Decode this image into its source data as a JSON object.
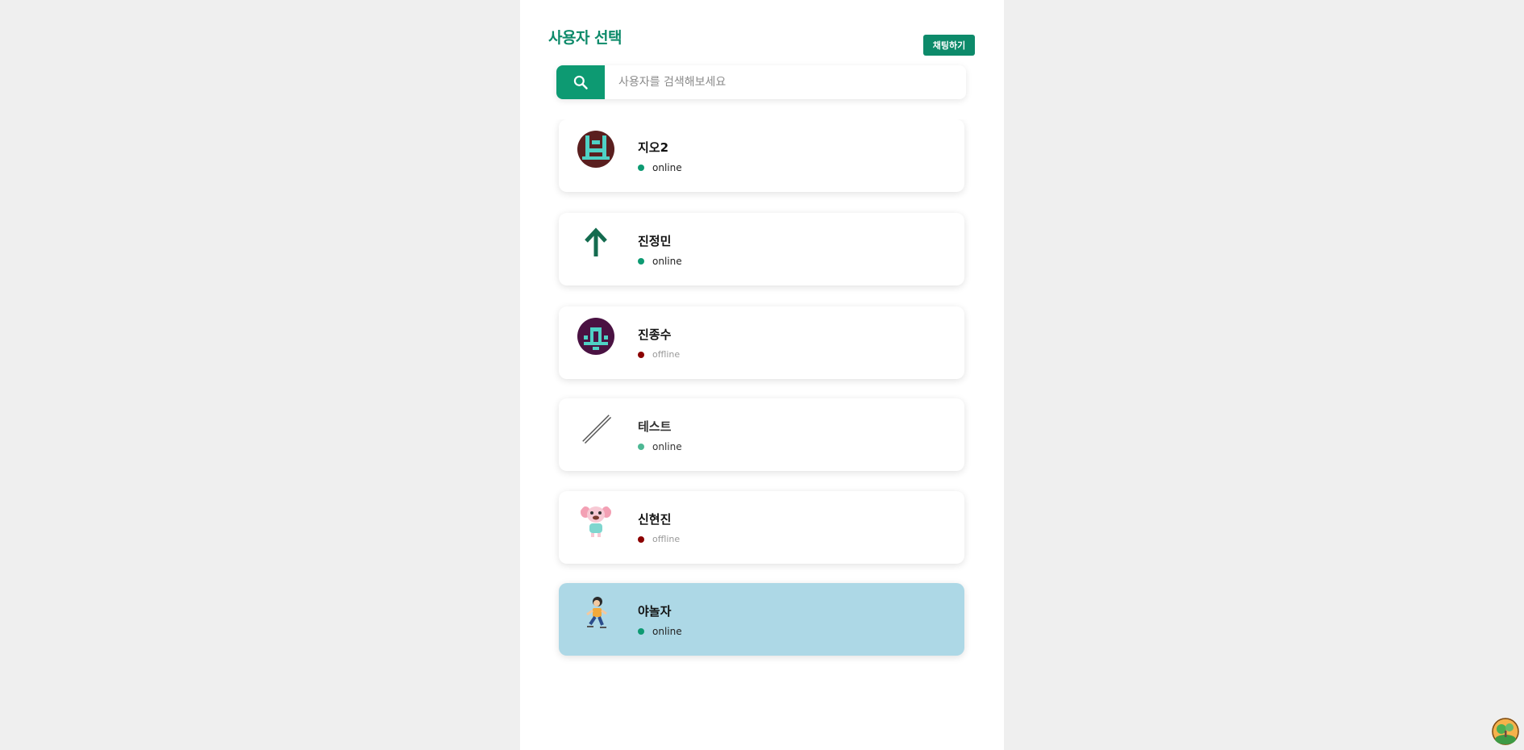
{
  "header": {
    "title": "사용자 선택",
    "chat_button_label": "채팅하기"
  },
  "search": {
    "placeholder": "사용자를 검색해보세요",
    "value": ""
  },
  "colors": {
    "accent": "#0d8a6a",
    "online": "#0d9a72",
    "offline": "#8b0000",
    "selected": "#add8e6"
  },
  "users": [
    {
      "name": "지오2",
      "status": "online",
      "avatar": "pixel-identicon-icon"
    },
    {
      "name": "진정민",
      "status": "online",
      "avatar": "up-arrow-icon"
    },
    {
      "name": "진종수",
      "status": "offline",
      "avatar": "pixel-identicon-icon"
    },
    {
      "name": "테스트",
      "status": "online",
      "avatar": "diagonal-lines-icon"
    },
    {
      "name": "신현진",
      "status": "offline",
      "avatar": "dog-character-icon"
    },
    {
      "name": "야놀자",
      "status": "online",
      "avatar": "running-boy-icon",
      "selected": true
    }
  ]
}
